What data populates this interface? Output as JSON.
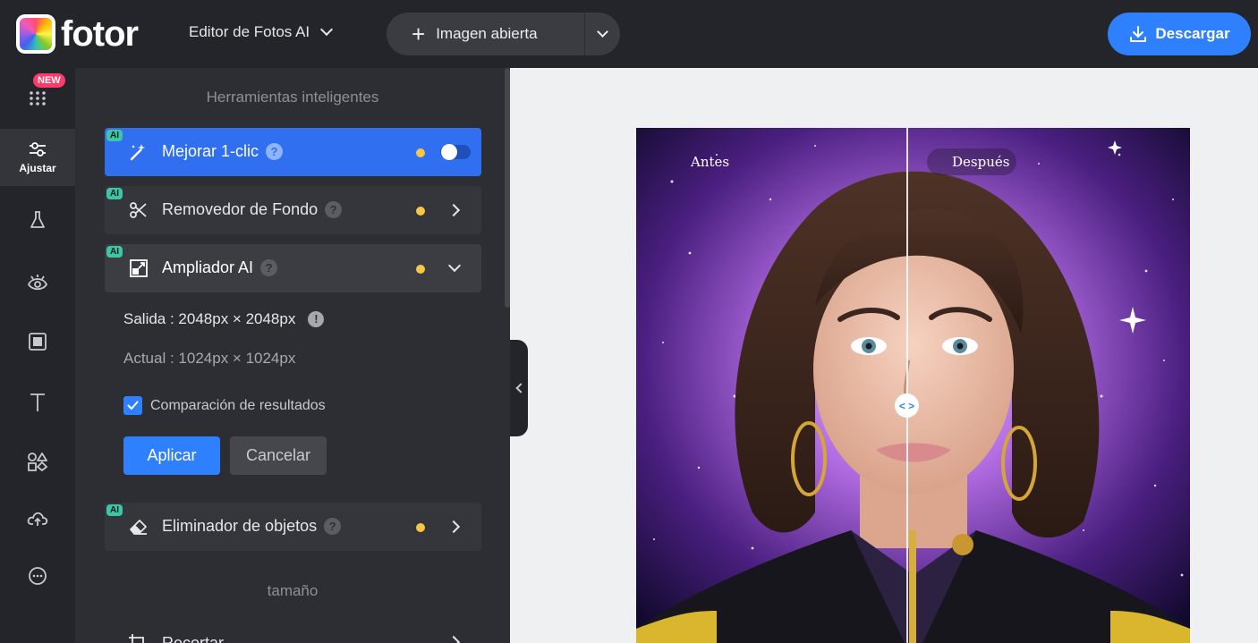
{
  "header": {
    "logo_text": "fotor",
    "editor_menu_label": "Editor de Fotos AI",
    "open_image_label": "Imagen abierta",
    "download_label": "Descargar"
  },
  "rail": {
    "new_badge": "NEW",
    "items": [
      {
        "icon": "apps-grid-icon"
      },
      {
        "icon": "sliders-icon",
        "label": "Ajustar",
        "active": true
      },
      {
        "icon": "flask-icon"
      },
      {
        "icon": "eye-icon"
      },
      {
        "icon": "frame-icon"
      },
      {
        "icon": "text-icon"
      },
      {
        "icon": "shapes-icon"
      },
      {
        "icon": "cloud-upload-icon"
      },
      {
        "icon": "more-icon"
      }
    ]
  },
  "panel": {
    "section_title": "Herramientas inteligentes",
    "ai_badge": "AI",
    "help_glyph": "?",
    "tools": [
      {
        "label": "Mejorar 1-clic",
        "icon": "magic-wand-icon",
        "control": "toggle"
      },
      {
        "label": "Removedor de Fondo",
        "icon": "scissors-icon",
        "control": "arrow"
      },
      {
        "label": "Ampliador AI",
        "icon": "expand-icon",
        "control": "collapse"
      },
      {
        "label": "Eliminador de objetos",
        "icon": "eraser-icon",
        "control": "arrow"
      }
    ],
    "upscaler": {
      "output_label": "Salida : 2048px × 2048px",
      "current_label": "Actual : 1024px × 1024px",
      "compare_label": "Comparación de resultados",
      "compare_checked": true,
      "apply_label": "Aplicar",
      "cancel_label": "Cancelar"
    },
    "size_section_title": "tamaño",
    "partial_item_label": "Recortar"
  },
  "canvas": {
    "before_label": "Antes",
    "after_label": "Después",
    "compare_handle_glyph": "< >"
  },
  "colors": {
    "accent": "#2f80ff",
    "active_tool": "#2f6ff0",
    "dot": "#f7c644",
    "ai_badge": "#3ec5a8",
    "new_badge": "#ff3b6b"
  }
}
